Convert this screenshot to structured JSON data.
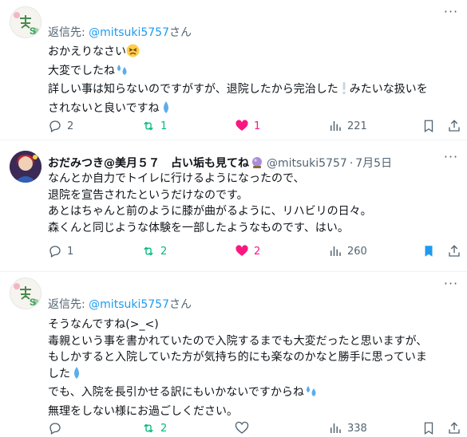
{
  "posts": [
    {
      "reply_prefix": "返信先: ",
      "reply_mention": "@mitsuki5757",
      "reply_suffix": "さん",
      "lines": [
        "おかえりなさい",
        "大変でしたね",
        "詳しい事は知らないのですがすが、退院したから完治した",
        "されないと良いですね"
      ],
      "line3_tail": "みたいな扱いを",
      "counts": {
        "replies": "2",
        "reposts": "1",
        "likes": "1",
        "views": "221"
      }
    },
    {
      "display_name": "おだみつき@美月５７　占い垢も見てね",
      "handle": "@mitsuki5757",
      "dot": "·",
      "date": "7月5日",
      "lines": [
        "なんとか自力でトイレに行けるようになったので、",
        "退院を宣告されたというだけなのです。",
        "あとはちゃんと前のように膝が曲がるように、リハビリの日々。",
        "森くんと同じような体験を一部したようなものです、はい。"
      ],
      "counts": {
        "replies": "1",
        "reposts": "2",
        "likes": "2",
        "views": "260"
      }
    },
    {
      "reply_prefix": "返信先: ",
      "reply_mention": "@mitsuki5757",
      "reply_suffix": "さん",
      "lines": [
        "そうなんですね(>_<)",
        "毒親という事を書かれていたので入院するまでも大変だったと思いますが、",
        "もしかすると入院していた方が気持ち的にも楽なのかなと勝手に思っていま",
        "した",
        "でも、入院を長引かせる訳にもいかないですからね",
        "無理をしない様にお過ごしください。"
      ],
      "counts": {
        "replies": "",
        "reposts": "2",
        "likes": "",
        "views": "338"
      }
    }
  ],
  "colors": {
    "accent": "#1d9bf0",
    "repost": "#00ba7c",
    "like": "#f91880",
    "muted": "#536471"
  },
  "icons": [
    "more-icon",
    "reply-icon",
    "repost-icon",
    "like-icon",
    "views-icon",
    "bookmark-icon",
    "share-icon",
    "drops-emoji",
    "tired-face-emoji",
    "crystal-ball-emoji",
    "exclamation-emoji",
    "droplet-emoji"
  ]
}
